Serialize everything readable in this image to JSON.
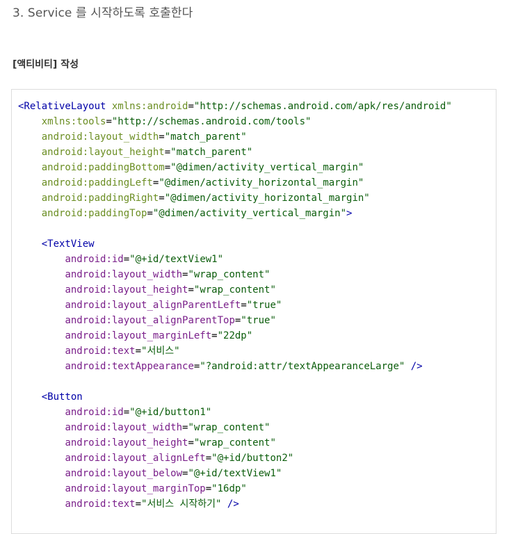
{
  "heading": "3. Service 를 시작하도록 호출한다",
  "subheading": "[액티비티] 작성",
  "code": {
    "root_open": "<RelativeLayout",
    "root_attrs": [
      {
        "name": "xmlns:android",
        "value": "\"http://schemas.android.com/apk/res/android\""
      },
      {
        "name": "xmlns:tools",
        "value": "\"http://schemas.android.com/tools\""
      },
      {
        "name": "android:layout_width",
        "value": "\"match_parent\""
      },
      {
        "name": "android:layout_height",
        "value": "\"match_parent\""
      },
      {
        "name": "android:paddingBottom",
        "value": "\"@dimen/activity_vertical_margin\""
      },
      {
        "name": "android:paddingLeft",
        "value": "\"@dimen/activity_horizontal_margin\""
      },
      {
        "name": "android:paddingRight",
        "value": "\"@dimen/activity_horizontal_margin\""
      },
      {
        "name": "android:paddingTop",
        "value": "\"@dimen/activity_vertical_margin\""
      }
    ],
    "root_close": ">",
    "textview_open": "<TextView",
    "textview_attrs": [
      {
        "name": "android:id",
        "value": "\"@+id/textView1\""
      },
      {
        "name": "android:layout_width",
        "value": "\"wrap_content\""
      },
      {
        "name": "android:layout_height",
        "value": "\"wrap_content\""
      },
      {
        "name": "android:layout_alignParentLeft",
        "value": "\"true\""
      },
      {
        "name": "android:layout_alignParentTop",
        "value": "\"true\""
      },
      {
        "name": "android:layout_marginLeft",
        "value": "\"22dp\""
      },
      {
        "name": "android:text",
        "value": "\"서비스\""
      },
      {
        "name": "android:textAppearance",
        "value": "\"?android:attr/textAppearanceLarge\""
      }
    ],
    "textview_close": " />",
    "button_open": "<Button",
    "button_attrs": [
      {
        "name": "android:id",
        "value": "\"@+id/button1\""
      },
      {
        "name": "android:layout_width",
        "value": "\"wrap_content\""
      },
      {
        "name": "android:layout_height",
        "value": "\"wrap_content\""
      },
      {
        "name": "android:layout_alignLeft",
        "value": "\"@+id/button2\""
      },
      {
        "name": "android:layout_below",
        "value": "\"@+id/textView1\""
      },
      {
        "name": "android:layout_marginTop",
        "value": "\"16dp\""
      },
      {
        "name": "android:text",
        "value": "\"서비스 시작하기\""
      }
    ],
    "button_close": " />"
  },
  "colors": {
    "tag": "#0000a8",
    "attribute": "#7a1f8a",
    "root_attribute": "#6b8e23",
    "value": "#0b5d0b"
  }
}
